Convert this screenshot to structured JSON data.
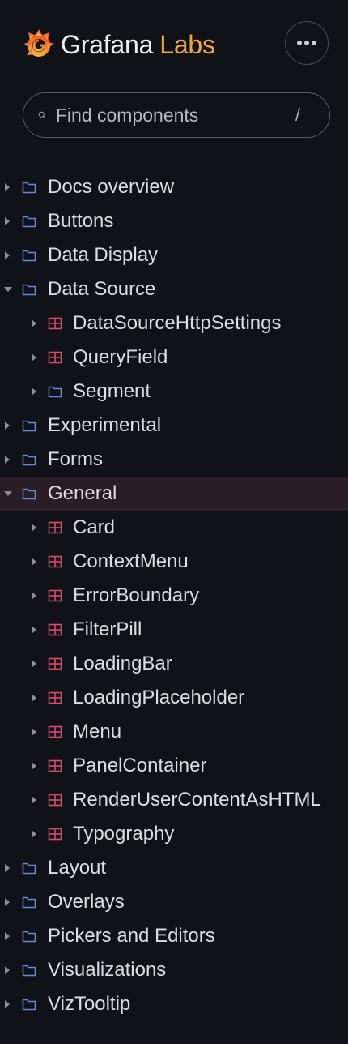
{
  "brand": {
    "name_primary": "Grafana",
    "name_secondary": "Labs",
    "accent_color": "#f0a53a"
  },
  "header": {
    "more_icon": "ellipsis-icon"
  },
  "search": {
    "placeholder": "Find components",
    "shortcut": "/",
    "icon": "search-icon"
  },
  "colors": {
    "background": "#111217",
    "folder_icon": "#5b8def",
    "component_icon": "#e0466a",
    "selected_row": "#2a1d26"
  },
  "tree": [
    {
      "label": "Docs overview",
      "type": "folder",
      "expanded": false
    },
    {
      "label": "Buttons",
      "type": "folder",
      "expanded": false
    },
    {
      "label": "Data Display",
      "type": "folder",
      "expanded": false
    },
    {
      "label": "Data Source",
      "type": "folder",
      "expanded": true,
      "children": [
        {
          "label": "DataSourceHttpSettings",
          "type": "component"
        },
        {
          "label": "QueryField",
          "type": "component"
        },
        {
          "label": "Segment",
          "type": "folder"
        }
      ]
    },
    {
      "label": "Experimental",
      "type": "folder",
      "expanded": false
    },
    {
      "label": "Forms",
      "type": "folder",
      "expanded": false
    },
    {
      "label": "General",
      "type": "folder",
      "expanded": true,
      "selected": true,
      "children": [
        {
          "label": "Card",
          "type": "component"
        },
        {
          "label": "ContextMenu",
          "type": "component"
        },
        {
          "label": "ErrorBoundary",
          "type": "component"
        },
        {
          "label": "FilterPill",
          "type": "component"
        },
        {
          "label": "LoadingBar",
          "type": "component"
        },
        {
          "label": "LoadingPlaceholder",
          "type": "component"
        },
        {
          "label": "Menu",
          "type": "component"
        },
        {
          "label": "PanelContainer",
          "type": "component"
        },
        {
          "label": "RenderUserContentAsHTML",
          "type": "component"
        },
        {
          "label": "Typography",
          "type": "component"
        }
      ]
    },
    {
      "label": "Layout",
      "type": "folder",
      "expanded": false
    },
    {
      "label": "Overlays",
      "type": "folder",
      "expanded": false
    },
    {
      "label": "Pickers and Editors",
      "type": "folder",
      "expanded": false
    },
    {
      "label": "Visualizations",
      "type": "folder",
      "expanded": false
    },
    {
      "label": "VizTooltip",
      "type": "folder",
      "expanded": false
    }
  ]
}
